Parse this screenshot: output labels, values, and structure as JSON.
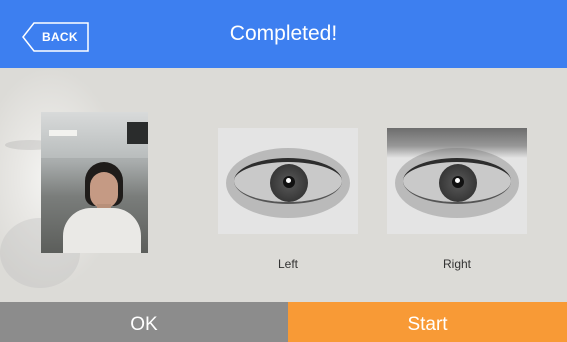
{
  "header": {
    "back_label": "BACK",
    "title": "Completed!",
    "color": "#3d7ff0"
  },
  "captures": {
    "face_photo_icon": "face-photo",
    "left_eye": {
      "label": "Left",
      "icon": "left-iris-image"
    },
    "right_eye": {
      "label": "Right",
      "icon": "right-iris-image"
    }
  },
  "footer": {
    "ok_label": "OK",
    "start_label": "Start",
    "ok_color": "#8c8c8c",
    "start_color": "#f89a36"
  }
}
